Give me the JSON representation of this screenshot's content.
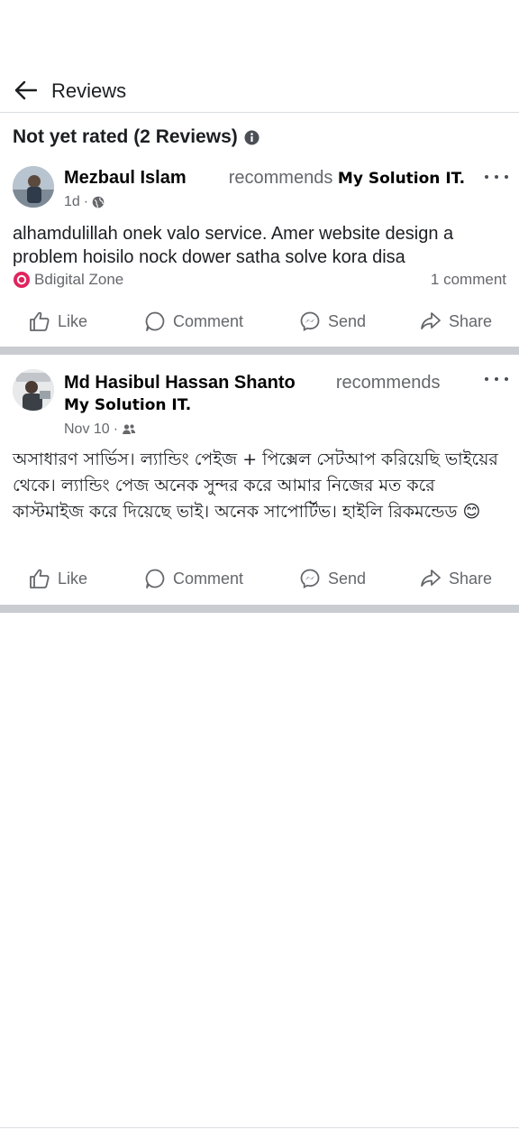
{
  "header": {
    "title": "Reviews",
    "back_icon": "arrow-left-icon"
  },
  "summary": {
    "rating_text": "Not yet rated (2 Reviews)",
    "info_icon": "info-icon"
  },
  "reviews": [
    {
      "author": "Mezbaul Islam",
      "verb": "recommends",
      "page": "My Solution IT.",
      "time": "1d",
      "privacy_icon": "globe-icon",
      "text": "alhamdulillah onek valo service.  Amer website design a problem hoisilo nock dower satha solve kora disa",
      "tag": "Bdigital Zone",
      "comments": "1 comment"
    },
    {
      "author": "Md Hasibul Hassan Shanto",
      "verb": "recommends",
      "page": "My Solution IT.",
      "time": "Nov 10",
      "privacy_icon": "friends-icon",
      "text": "অসাধারণ সার্ভিস। ল্যান্ডিং পেইজ + পিক্সেল সেটআপ করিয়েছি ভাইয়ের থেকে। ল্যান্ডিং পেজ অনেক সুন্দর করে আমার নিজের মত করে কাস্টমাইজ করে দিয়েছে ভাই। অনেক সাপোর্টিভ। হাইলি রিকমন্ডেড 😊"
    }
  ],
  "actions": {
    "like": "Like",
    "comment": "Comment",
    "send": "Send",
    "share": "Share"
  },
  "colors": {
    "text_primary": "#050505",
    "text_secondary": "#65676b",
    "divider": "#c9ccd1",
    "tag_badge": "#e0245e"
  }
}
